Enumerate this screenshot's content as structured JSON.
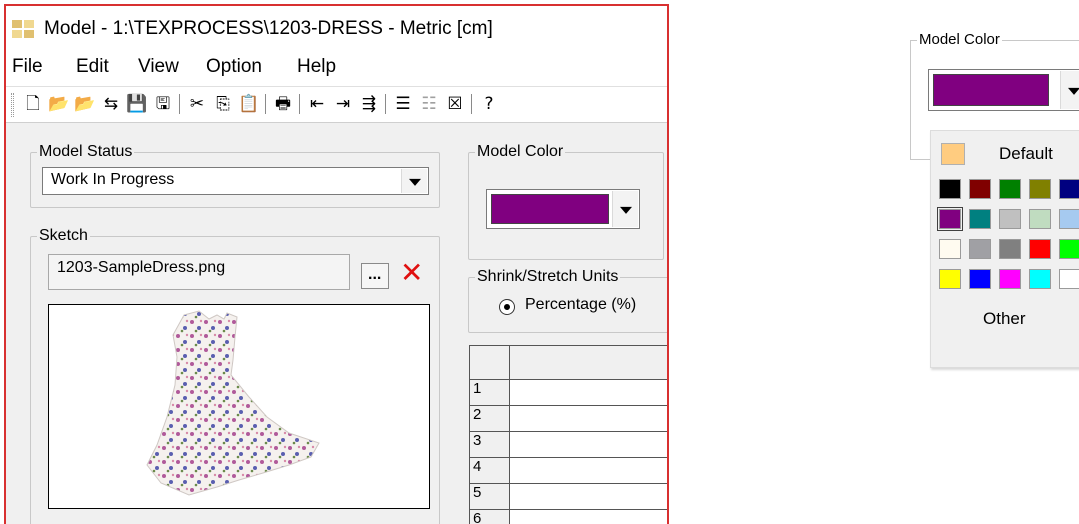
{
  "window": {
    "title": "Model - 1:\\TEXPROCESS\\1203-DRESS - Metric [cm]"
  },
  "menu": [
    "File",
    "Edit",
    "View",
    "Option",
    "Help"
  ],
  "toolbar": {
    "buttons": [
      {
        "icon": "new-file-icon",
        "glyph": "🗋"
      },
      {
        "icon": "open-folder-icon",
        "glyph": "📂"
      },
      {
        "icon": "open-folder-2-icon",
        "glyph": "📂"
      },
      {
        "icon": "import-icon",
        "glyph": "⇆"
      },
      {
        "icon": "save-icon",
        "glyph": "💾"
      },
      {
        "icon": "save-all-icon",
        "glyph": "🖫"
      },
      {
        "icon": "cut-icon",
        "glyph": "✂"
      },
      {
        "icon": "copy-icon",
        "glyph": "⎘"
      },
      {
        "icon": "paste-icon",
        "glyph": "📋"
      },
      {
        "icon": "print-icon",
        "glyph": "🖶"
      },
      {
        "icon": "move-left-icon",
        "glyph": "⇤"
      },
      {
        "icon": "move-right-icon",
        "glyph": "⇥"
      },
      {
        "icon": "insert-icon",
        "glyph": "⇶"
      },
      {
        "icon": "list-icon",
        "glyph": "☰"
      },
      {
        "icon": "list-disabled-icon",
        "glyph": "☷"
      },
      {
        "icon": "delete-list-icon",
        "glyph": "☒"
      },
      {
        "icon": "help-icon",
        "glyph": "?"
      }
    ]
  },
  "model_status": {
    "label": "Model Status",
    "value": "Work In Progress"
  },
  "sketch": {
    "label": "Sketch",
    "filename": "1203-SampleDress.png",
    "browse_label": "...",
    "delete_glyph": "✕"
  },
  "model_color": {
    "label": "Model Color",
    "value_color": "#800080"
  },
  "shrink": {
    "label": "Shrink/Stretch Units",
    "option": "Percentage (%)"
  },
  "grid": {
    "rows": [
      "1",
      "2",
      "3",
      "4",
      "5",
      "6"
    ]
  },
  "popup": {
    "group_label": "Model Color",
    "selected_color": "#800080",
    "default_label": "Default",
    "default_color": "#ffcc80",
    "other_label": "Other",
    "swatches": [
      [
        "#000000",
        "#800000",
        "#008000",
        "#808000",
        "#000080"
      ],
      [
        "#800080",
        "#008080",
        "#c0c0c0",
        "#c0dcc0",
        "#a6caf0"
      ],
      [
        "#fffbf0",
        "#a0a0a4",
        "#808080",
        "#ff0000",
        "#00ff00"
      ],
      [
        "#ffff00",
        "#0000ff",
        "#ff00ff",
        "#00ffff",
        "#ffffff"
      ]
    ]
  }
}
